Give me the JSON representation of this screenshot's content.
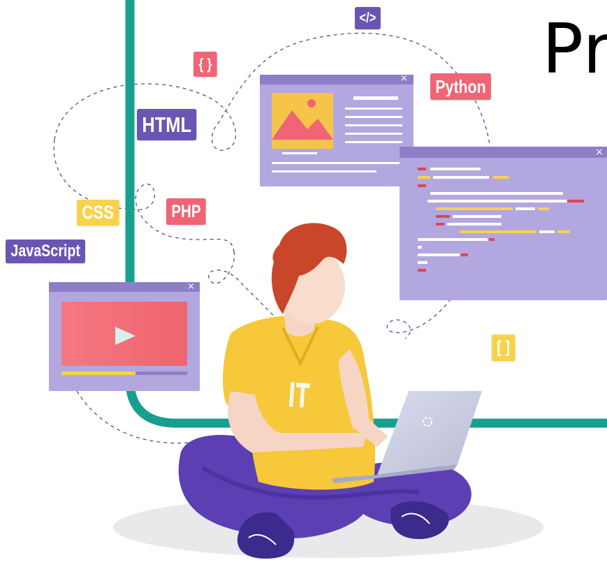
{
  "title": {
    "text": "Pr"
  },
  "tags": {
    "code": "</>",
    "braces": "{ }",
    "python": "Python",
    "html": "HTML",
    "css": "CSS",
    "php": "PHP",
    "javascript": "JavaScript",
    "brackets": "[ ]"
  },
  "shirt": {
    "text": "IT"
  },
  "window_close_glyph": "×",
  "colors": {
    "teal_frame": "#17a08e",
    "purple_tag": "#6a55b4",
    "pink_tag": "#f06475",
    "yellow_tag": "#f8d24a",
    "window_purple": "#8e7ec9",
    "window_bg": "#b3a7df",
    "shirt_yellow": "#f6c83a",
    "hair": "#c9462a",
    "pants_purple": "#5b3fb3",
    "laptop": "#cfd2e3"
  },
  "icons": [
    "image-placeholder-icon",
    "play-icon",
    "close-icon",
    "laptop-logo-icon"
  ]
}
